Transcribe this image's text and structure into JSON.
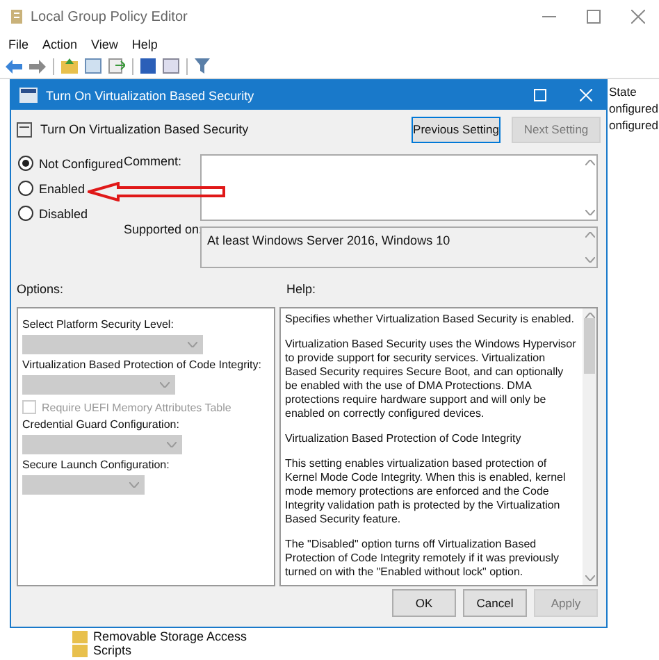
{
  "window": {
    "title": "Local Group Policy Editor"
  },
  "menu": [
    "File",
    "Action",
    "View",
    "Help"
  ],
  "state_column": {
    "header": "State",
    "cells": [
      "onfigured",
      "onfigured"
    ]
  },
  "tree": [
    "Removable Storage Access",
    "Scripts"
  ],
  "dialog": {
    "title": "Turn On Virtualization Based Security",
    "setting_name": "Turn On Virtualization Based Security",
    "nav_buttons": [
      {
        "label": "Previous Setting",
        "disabled": false
      },
      {
        "label": "Next Setting",
        "disabled": true
      }
    ],
    "radios": [
      {
        "label": "Not Configured",
        "selected": true
      },
      {
        "label": "Enabled",
        "selected": false
      },
      {
        "label": "Disabled",
        "selected": false
      }
    ],
    "comment_label": "Comment:",
    "supported_label": "Supported on:",
    "supported_value": "At least Windows Server 2016, Windows 10",
    "options_label": "Options:",
    "help_label": "Help:",
    "options": [
      {
        "kind": "dropdown",
        "label": "Select Platform Security Level:",
        "disabled": true
      },
      {
        "kind": "dropdown",
        "label": "Virtualization Based Protection of Code Integrity:",
        "disabled": true
      },
      {
        "kind": "checkbox",
        "label": "Require UEFI Memory Attributes Table",
        "checked": false,
        "disabled": true
      },
      {
        "kind": "dropdown",
        "label": "Credential Guard Configuration:",
        "disabled": true
      },
      {
        "kind": "dropdown",
        "label": "Secure Launch Configuration:",
        "disabled": true
      }
    ],
    "help": [
      "Specifies whether Virtualization Based Security is enabled.",
      "Virtualization Based Security uses the Windows Hypervisor to provide support for security services. Virtualization Based Security requires Secure Boot, and can optionally be enabled with the use of DMA Protections. DMA protections require hardware support and will only be enabled on correctly configured devices.",
      "Virtualization Based Protection of Code Integrity",
      "This setting enables virtualization based protection of Kernel Mode Code Integrity. When this is enabled, kernel mode memory protections are enforced and the Code Integrity validation path is protected by the Virtualization Based Security feature.",
      "The \"Disabled\" option turns off Virtualization Based Protection of Code Integrity remotely if it was previously turned on with the \"Enabled without lock\" option."
    ],
    "buttons": [
      {
        "label": "OK",
        "disabled": false
      },
      {
        "label": "Cancel",
        "disabled": false
      },
      {
        "label": "Apply",
        "disabled": true
      }
    ]
  }
}
